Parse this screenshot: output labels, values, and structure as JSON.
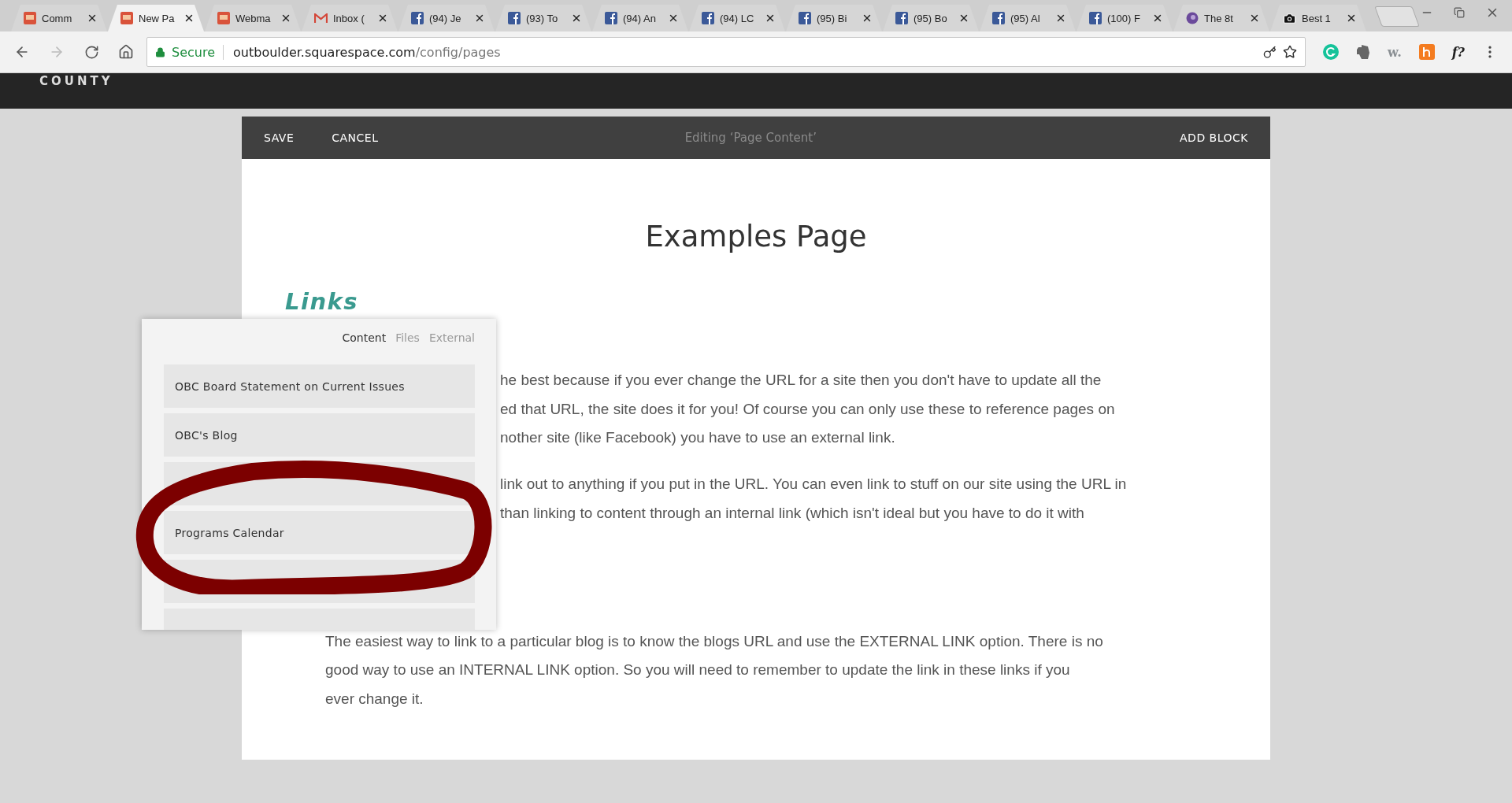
{
  "browser": {
    "tabs": [
      {
        "title": "Comm",
        "kind": "obc",
        "selected": false
      },
      {
        "title": "New Pa",
        "kind": "obc",
        "selected": true
      },
      {
        "title": "Webma",
        "kind": "obc",
        "selected": false
      },
      {
        "title": "Inbox (",
        "kind": "gmail",
        "selected": false
      },
      {
        "title": "(94) Je",
        "kind": "facebook",
        "selected": false
      },
      {
        "title": "(93) To",
        "kind": "facebook",
        "selected": false
      },
      {
        "title": "(94) An",
        "kind": "facebook",
        "selected": false
      },
      {
        "title": "(94) LC",
        "kind": "facebook",
        "selected": false
      },
      {
        "title": "(95) Bi",
        "kind": "facebook",
        "selected": false
      },
      {
        "title": "(95) Bo",
        "kind": "facebook",
        "selected": false
      },
      {
        "title": "(95) Al",
        "kind": "facebook",
        "selected": false
      },
      {
        "title": "(100) F",
        "kind": "facebook",
        "selected": false
      },
      {
        "title": "The 8t",
        "kind": "drop",
        "selected": false
      },
      {
        "title": "Best 1",
        "kind": "camera",
        "selected": false
      }
    ],
    "address": {
      "secure_label": "Secure",
      "host": "outboulder.squarespace.com",
      "path": "/config/pages"
    },
    "extensions": [
      {
        "kind": "grammarly"
      },
      {
        "kind": "evernote"
      },
      {
        "kind": "text",
        "label": "w."
      },
      {
        "kind": "honey"
      },
      {
        "kind": "text",
        "label": "f?"
      }
    ]
  },
  "site_header": {
    "text": "COUNTY"
  },
  "editor": {
    "toolbar": {
      "left": [
        "SAVE",
        "CANCEL"
      ],
      "title": "Editing ‘Page Content’",
      "right": "ADD BLOCK"
    },
    "page_title": "Examples Page",
    "heading": "Links",
    "paragraphs": [
      {
        "kind": "beside-popup",
        "lines": [
          "he best because if you ever change the URL for a site then you don't have to update all the",
          "ed that URL, the site does it for you! Of course you can only use these to reference pages on",
          "nother site (like Facebook) you have to use an external link."
        ]
      },
      {
        "kind": "beside-popup",
        "lines": [
          "link out to anything if you put in the URL. You can even link to stuff on our site using the URL in",
          "than linking to content through an internal link (which isn't ideal but you have to do it with"
        ]
      },
      {
        "kind": "full",
        "lines": [
          "The easiest way to link to a particular blog is to know the blogs URL and use the EXTERNAL LINK option. There is no",
          "good way to use an INTERNAL LINK option. So you will need to remember to update the link in these links if you",
          "ever change it."
        ]
      }
    ]
  },
  "link_popup": {
    "tabs": [
      {
        "label": "Content",
        "selected": true
      },
      {
        "label": "Files",
        "selected": false
      },
      {
        "label": "External",
        "selected": false
      }
    ],
    "items": [
      {
        "kind": "page",
        "label": "OBC Board Statement on Current Issues"
      },
      {
        "kind": "page",
        "label": "OBC's Blog"
      },
      {
        "kind": "blank"
      },
      {
        "kind": "page",
        "label": "Programs Calendar"
      },
      {
        "kind": "blank"
      },
      {
        "kind": "partial"
      }
    ]
  },
  "annotation": {
    "kind": "marker-loop"
  }
}
